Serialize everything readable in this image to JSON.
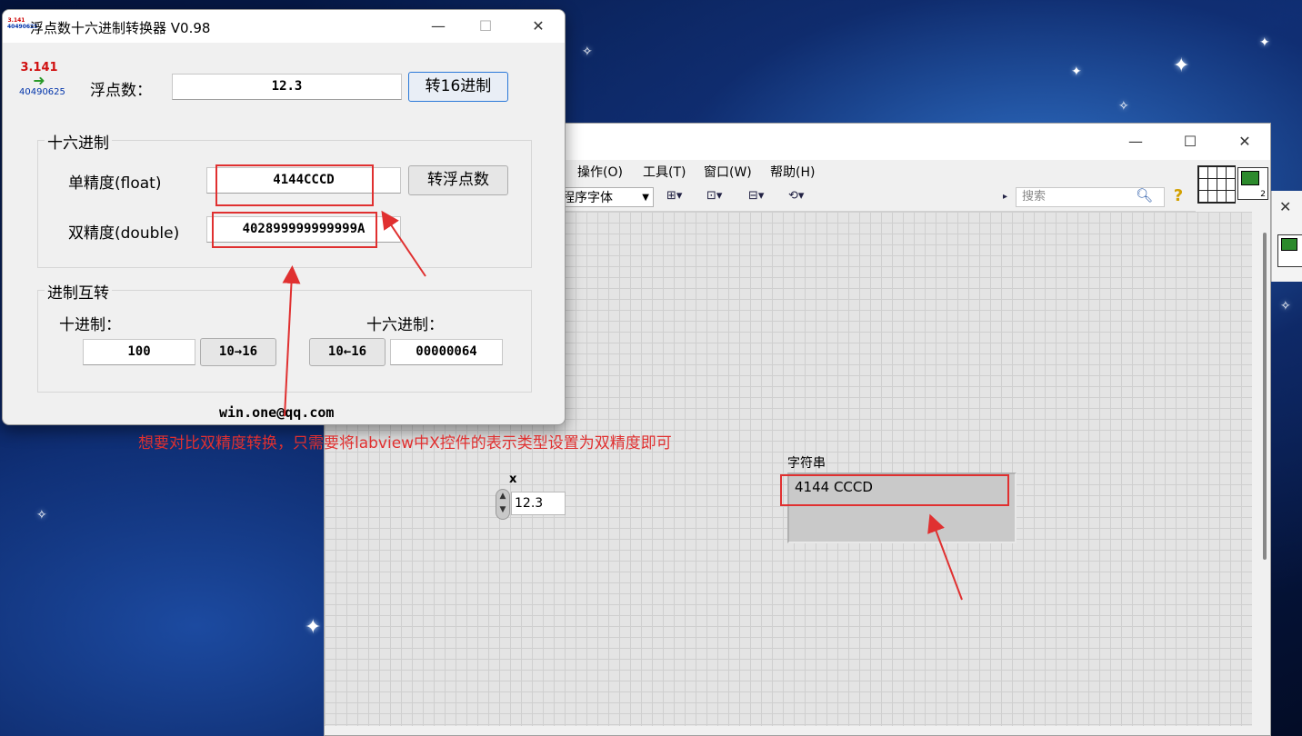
{
  "converter": {
    "title": "浮点数十六进制转换器 V0.98",
    "app_icon": {
      "line1": "3.141",
      "line2": "40490625"
    },
    "float_label": "浮点数：",
    "float_value": "12.3",
    "to_hex_button": "转16进制",
    "hex_group_title": "十六进制",
    "single_label": "单精度(float)",
    "single_value": "4144CCCD",
    "to_float_button": "转浮点数",
    "double_label": "双精度(double)",
    "double_value": "402899999999999A",
    "radix_group_title": "进制互转",
    "decimal_label": "十进制：",
    "decimal_value": "100",
    "dec_to_hex_button": "10→16",
    "hex_label": "十六进制：",
    "hex_to_dec_button": "10←16",
    "hex_value": "00000064",
    "email": "win.one@qq.com",
    "window_controls": {
      "minimize": "—",
      "maximize": "☐",
      "close": "✕"
    }
  },
  "annotation": {
    "note": "想要对比双精度转换，只需要将labview中X控件的表示类型设置为双精度即可",
    "color": "#e03030"
  },
  "labview": {
    "window_controls": {
      "minimize": "—",
      "maximize": "☐",
      "close": "✕"
    },
    "menu": [
      {
        "label": "操作(O)"
      },
      {
        "label": "工具(T)"
      },
      {
        "label": "窗口(W)"
      },
      {
        "label": "帮助(H)"
      }
    ],
    "font_select": "程序字体",
    "search_placeholder": "搜索",
    "vi_icon_number": "2",
    "x_control": {
      "label": "x",
      "value": "12.3"
    },
    "string_indicator": {
      "label": "字符串",
      "value": "4144 CCCD"
    }
  },
  "icons": [
    "search-icon",
    "help-icon",
    "connector-pane-icon",
    "vi-icon",
    "align-icon",
    "distribute-icon",
    "resize-icon",
    "reorder-icon"
  ]
}
